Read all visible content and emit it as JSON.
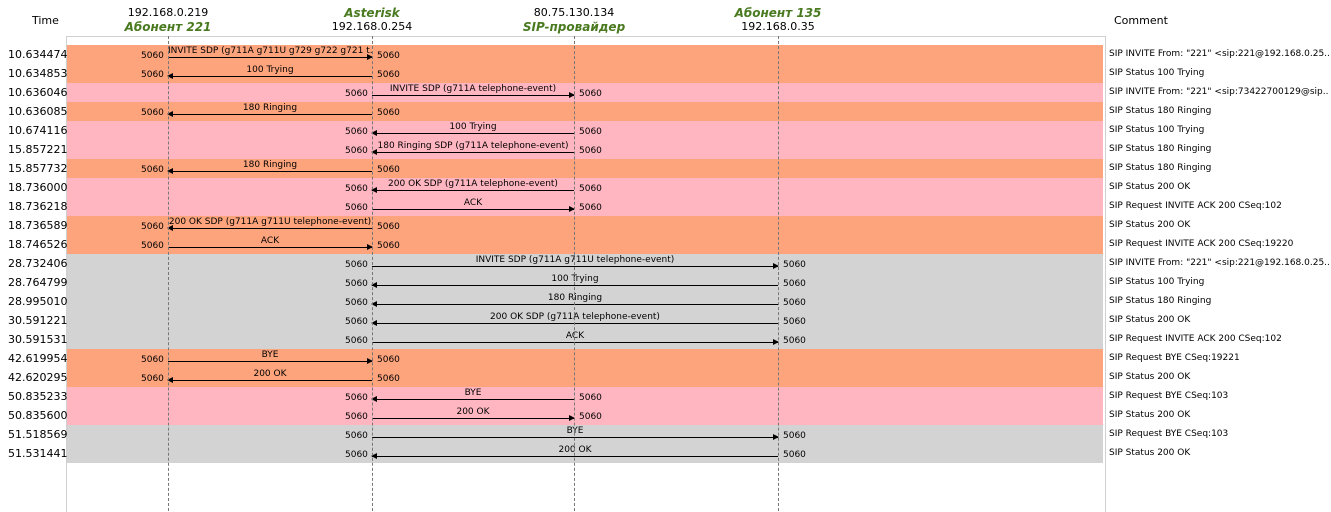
{
  "headers": {
    "time": "Time",
    "comment": "Comment"
  },
  "hosts": [
    {
      "ip": "192.168.0.219",
      "alias": "Абонент 221"
    },
    {
      "ip": "192.168.0.254",
      "alias": "Asterisk"
    },
    {
      "ip": "80.75.130.134",
      "alias": "SIP-провайдер"
    },
    {
      "ip": "192.168.0.35",
      "alias": "Абонент 135"
    }
  ],
  "colors": {
    "orange": "#fda47d",
    "pink": "#ffb6c1",
    "gray": "#d3d3d3"
  },
  "rows": [
    {
      "time": "10.634474",
      "color": "orange",
      "from": 0,
      "to": 1,
      "from_port": "5060",
      "to_port": "5060",
      "label": "INVITE SDP (g711A g711U g729 g722 g721 t...",
      "comment": "SIP INVITE From: \"221\" <sip:221@192.168.0.25..."
    },
    {
      "time": "10.634853",
      "color": "orange",
      "from": 1,
      "to": 0,
      "from_port": "5060",
      "to_port": "5060",
      "label": "100 Trying",
      "comment": "SIP Status 100 Trying"
    },
    {
      "time": "10.636046",
      "color": "pink",
      "from": 1,
      "to": 2,
      "from_port": "5060",
      "to_port": "5060",
      "label": "INVITE SDP (g711A telephone-event)",
      "comment": "SIP INVITE From: \"221\" <sip:73422700129@sip...."
    },
    {
      "time": "10.636085",
      "color": "orange",
      "from": 1,
      "to": 0,
      "from_port": "5060",
      "to_port": "5060",
      "label": "180 Ringing",
      "comment": "SIP Status 180 Ringing"
    },
    {
      "time": "10.674116",
      "color": "pink",
      "from": 2,
      "to": 1,
      "from_port": "5060",
      "to_port": "5060",
      "label": "100 Trying",
      "comment": "SIP Status 100 Trying"
    },
    {
      "time": "15.857221",
      "color": "pink",
      "from": 2,
      "to": 1,
      "from_port": "5060",
      "to_port": "5060",
      "label": "180 Ringing SDP (g711A telephone-event)",
      "comment": "SIP Status 180 Ringing"
    },
    {
      "time": "15.857732",
      "color": "orange",
      "from": 1,
      "to": 0,
      "from_port": "5060",
      "to_port": "5060",
      "label": "180 Ringing",
      "comment": "SIP Status 180 Ringing"
    },
    {
      "time": "18.736000",
      "color": "pink",
      "from": 2,
      "to": 1,
      "from_port": "5060",
      "to_port": "5060",
      "label": "200 OK SDP (g711A telephone-event)",
      "comment": "SIP Status 200 OK"
    },
    {
      "time": "18.736218",
      "color": "pink",
      "from": 1,
      "to": 2,
      "from_port": "5060",
      "to_port": "5060",
      "label": "ACK",
      "comment": "SIP Request INVITE ACK 200 CSeq:102"
    },
    {
      "time": "18.736589",
      "color": "orange",
      "from": 1,
      "to": 0,
      "from_port": "5060",
      "to_port": "5060",
      "label": "200 OK SDP (g711A g711U telephone-event)",
      "comment": "SIP Status 200 OK"
    },
    {
      "time": "18.746526",
      "color": "orange",
      "from": 0,
      "to": 1,
      "from_port": "5060",
      "to_port": "5060",
      "label": "ACK",
      "comment": "SIP Request INVITE ACK 200 CSeq:19220"
    },
    {
      "time": "28.732406",
      "color": "gray",
      "from": 1,
      "to": 3,
      "from_port": "5060",
      "to_port": "5060",
      "label": "INVITE SDP (g711A g711U telephone-event)",
      "comment": "SIP INVITE From: \"221\" <sip:221@192.168.0.25..."
    },
    {
      "time": "28.764799",
      "color": "gray",
      "from": 3,
      "to": 1,
      "from_port": "5060",
      "to_port": "5060",
      "label": "100 Trying",
      "comment": "SIP Status 100 Trying"
    },
    {
      "time": "28.995010",
      "color": "gray",
      "from": 3,
      "to": 1,
      "from_port": "5060",
      "to_port": "5060",
      "label": "180 Ringing",
      "comment": "SIP Status 180 Ringing"
    },
    {
      "time": "30.591221",
      "color": "gray",
      "from": 3,
      "to": 1,
      "from_port": "5060",
      "to_port": "5060",
      "label": "200 OK SDP (g711A telephone-event)",
      "comment": "SIP Status 200 OK"
    },
    {
      "time": "30.591531",
      "color": "gray",
      "from": 1,
      "to": 3,
      "from_port": "5060",
      "to_port": "5060",
      "label": "ACK",
      "comment": "SIP Request INVITE ACK 200 CSeq:102"
    },
    {
      "time": "42.619954",
      "color": "orange",
      "from": 0,
      "to": 1,
      "from_port": "5060",
      "to_port": "5060",
      "label": "BYE",
      "comment": "SIP Request BYE CSeq:19221"
    },
    {
      "time": "42.620295",
      "color": "orange",
      "from": 1,
      "to": 0,
      "from_port": "5060",
      "to_port": "5060",
      "label": "200 OK",
      "comment": "SIP Status 200 OK"
    },
    {
      "time": "50.835233",
      "color": "pink",
      "from": 2,
      "to": 1,
      "from_port": "5060",
      "to_port": "5060",
      "label": "BYE",
      "comment": "SIP Request BYE CSeq:103"
    },
    {
      "time": "50.835600",
      "color": "pink",
      "from": 1,
      "to": 2,
      "from_port": "5060",
      "to_port": "5060",
      "label": "200 OK",
      "comment": "SIP Status 200 OK"
    },
    {
      "time": "51.518569",
      "color": "gray",
      "from": 1,
      "to": 3,
      "from_port": "5060",
      "to_port": "5060",
      "label": "BYE",
      "comment": "SIP Request BYE CSeq:103"
    },
    {
      "time": "51.531441",
      "color": "gray",
      "from": 3,
      "to": 1,
      "from_port": "5060",
      "to_port": "5060",
      "label": "200 OK",
      "comment": "SIP Status 200 OK"
    }
  ]
}
